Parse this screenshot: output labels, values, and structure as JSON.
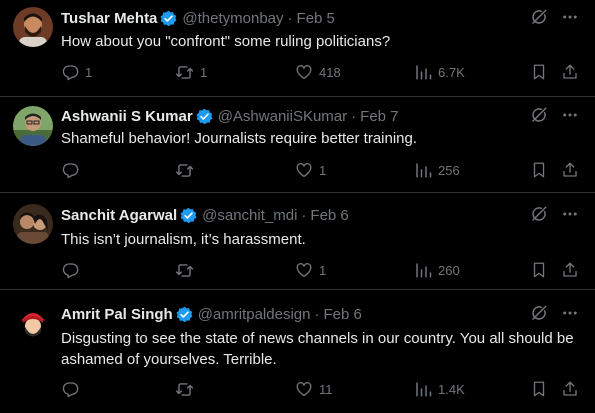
{
  "tweets": [
    {
      "name": "Tushar Mehta",
      "handle": "@thetymonbay",
      "separator": "·",
      "date": "Feb 5",
      "text": "How about you \"confront\" some ruling politicians?",
      "replies": "1",
      "retweets": "1",
      "likes": "418",
      "views": "6.7K",
      "avatar_icon": "avatar-bearded-man"
    },
    {
      "name": "Ashwanii S Kumar",
      "handle": "@AshwaniiSKumar",
      "separator": "·",
      "date": "Feb 7",
      "text": "Shameful behavior! Journalists require better training.",
      "replies": "",
      "retweets": "",
      "likes": "1",
      "views": "256",
      "avatar_icon": "avatar-man-glasses-outdoor"
    },
    {
      "name": "Sanchit Agarwal",
      "handle": "@sanchit_mdi",
      "separator": "·",
      "date": "Feb 6",
      "text": "This isn’t journalism, it’s harassment.",
      "replies": "",
      "retweets": "",
      "likes": "1",
      "views": "260",
      "avatar_icon": "avatar-couple-photo"
    },
    {
      "name": "Amrit Pal Singh",
      "handle": "@amritpaldesign",
      "separator": "·",
      "date": "Feb 6",
      "text": "Disgusting to see the state of news channels in our country. You all should be ashamed of yourselves. Terrible.",
      "replies": "",
      "retweets": "",
      "likes": "11",
      "views": "1.4K",
      "avatar_icon": "avatar-cartoon-red-turban"
    }
  ],
  "colors": {
    "background": "#000000",
    "text_primary": "#e7e9ea",
    "text_secondary": "#71767b",
    "divider": "#2f3336",
    "verified_blue": "#1d9bf0"
  },
  "icons": {
    "verified": "verified-badge-icon",
    "grok": "grok-icon",
    "more": "more-icon",
    "reply": "reply-icon",
    "retweet": "retweet-icon",
    "like": "like-icon",
    "views": "views-icon",
    "bookmark": "bookmark-icon",
    "share": "share-icon"
  }
}
